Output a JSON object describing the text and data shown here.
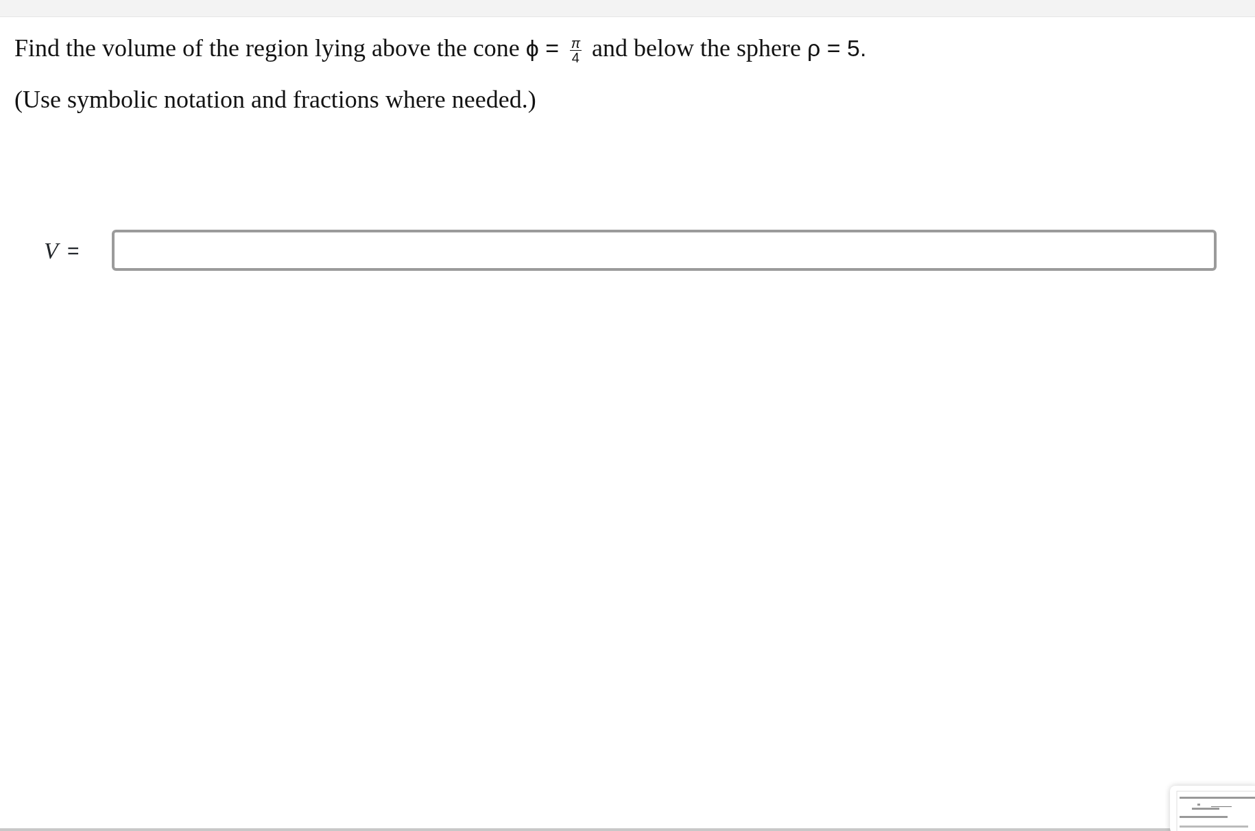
{
  "question": {
    "parts": [
      {
        "kind": "text",
        "text": "Find the volume of the region lying above the cone "
      },
      {
        "kind": "math",
        "text": "ϕ = "
      },
      {
        "kind": "fraction",
        "numerator": "π",
        "denominator": "4"
      },
      {
        "kind": "text",
        "text": " and below the sphere "
      },
      {
        "kind": "math",
        "text": "ρ = 5."
      }
    ]
  },
  "hint": "(Use symbolic notation and fractions where needed.)",
  "answer": {
    "label": "V",
    "equals": "="
  }
}
